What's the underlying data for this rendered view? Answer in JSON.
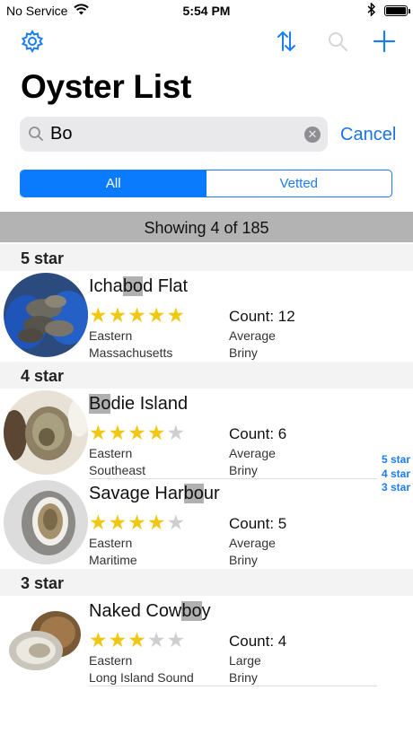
{
  "status_bar": {
    "carrier": "No Service",
    "time": "5:54 PM"
  },
  "nav": {
    "title": "Oyster List",
    "icons": [
      "gear-icon",
      "sort-icon",
      "search-icon",
      "plus-icon"
    ]
  },
  "search": {
    "query": "Bo",
    "cancel_label": "Cancel"
  },
  "segments": {
    "all": "All",
    "vetted": "Vetted",
    "selected": "All"
  },
  "summary": "Showing 4 of 185",
  "colors": {
    "accent": "#1b7cf4",
    "star": "#f0c814",
    "star_off": "#cfcfcf",
    "highlight": "#b0b0b0"
  },
  "sections": [
    {
      "header": "5 star",
      "rows": [
        {
          "name_pre": "Icha",
          "name_hl": "bo",
          "name_post": "d Flat",
          "rating": 5,
          "count": "Count: 12",
          "coast": "Eastern",
          "region": "Massachusetts",
          "size": "Average",
          "flavor": "Briny"
        }
      ]
    },
    {
      "header": "4 star",
      "rows": [
        {
          "name_pre": "",
          "name_hl": "Bo",
          "name_post": "die Island",
          "rating": 4,
          "count": "Count: 6",
          "coast": "Eastern",
          "region": "Southeast",
          "size": "Average",
          "flavor": "Briny"
        },
        {
          "name_pre": "Savage Har",
          "name_hl": "bo",
          "name_post": "ur",
          "rating": 4,
          "count": "Count: 5",
          "coast": "Eastern",
          "region": "Maritime",
          "size": "Average",
          "flavor": "Briny"
        }
      ]
    },
    {
      "header": "3 star",
      "rows": [
        {
          "name_pre": "Naked Cow",
          "name_hl": "bo",
          "name_post": "y",
          "rating": 3,
          "count": "Count: 4",
          "coast": "Eastern",
          "region": "Long Island Sound",
          "size": "Large",
          "flavor": "Briny"
        }
      ]
    }
  ],
  "index": [
    "5 star",
    "4 star",
    "3 star"
  ]
}
